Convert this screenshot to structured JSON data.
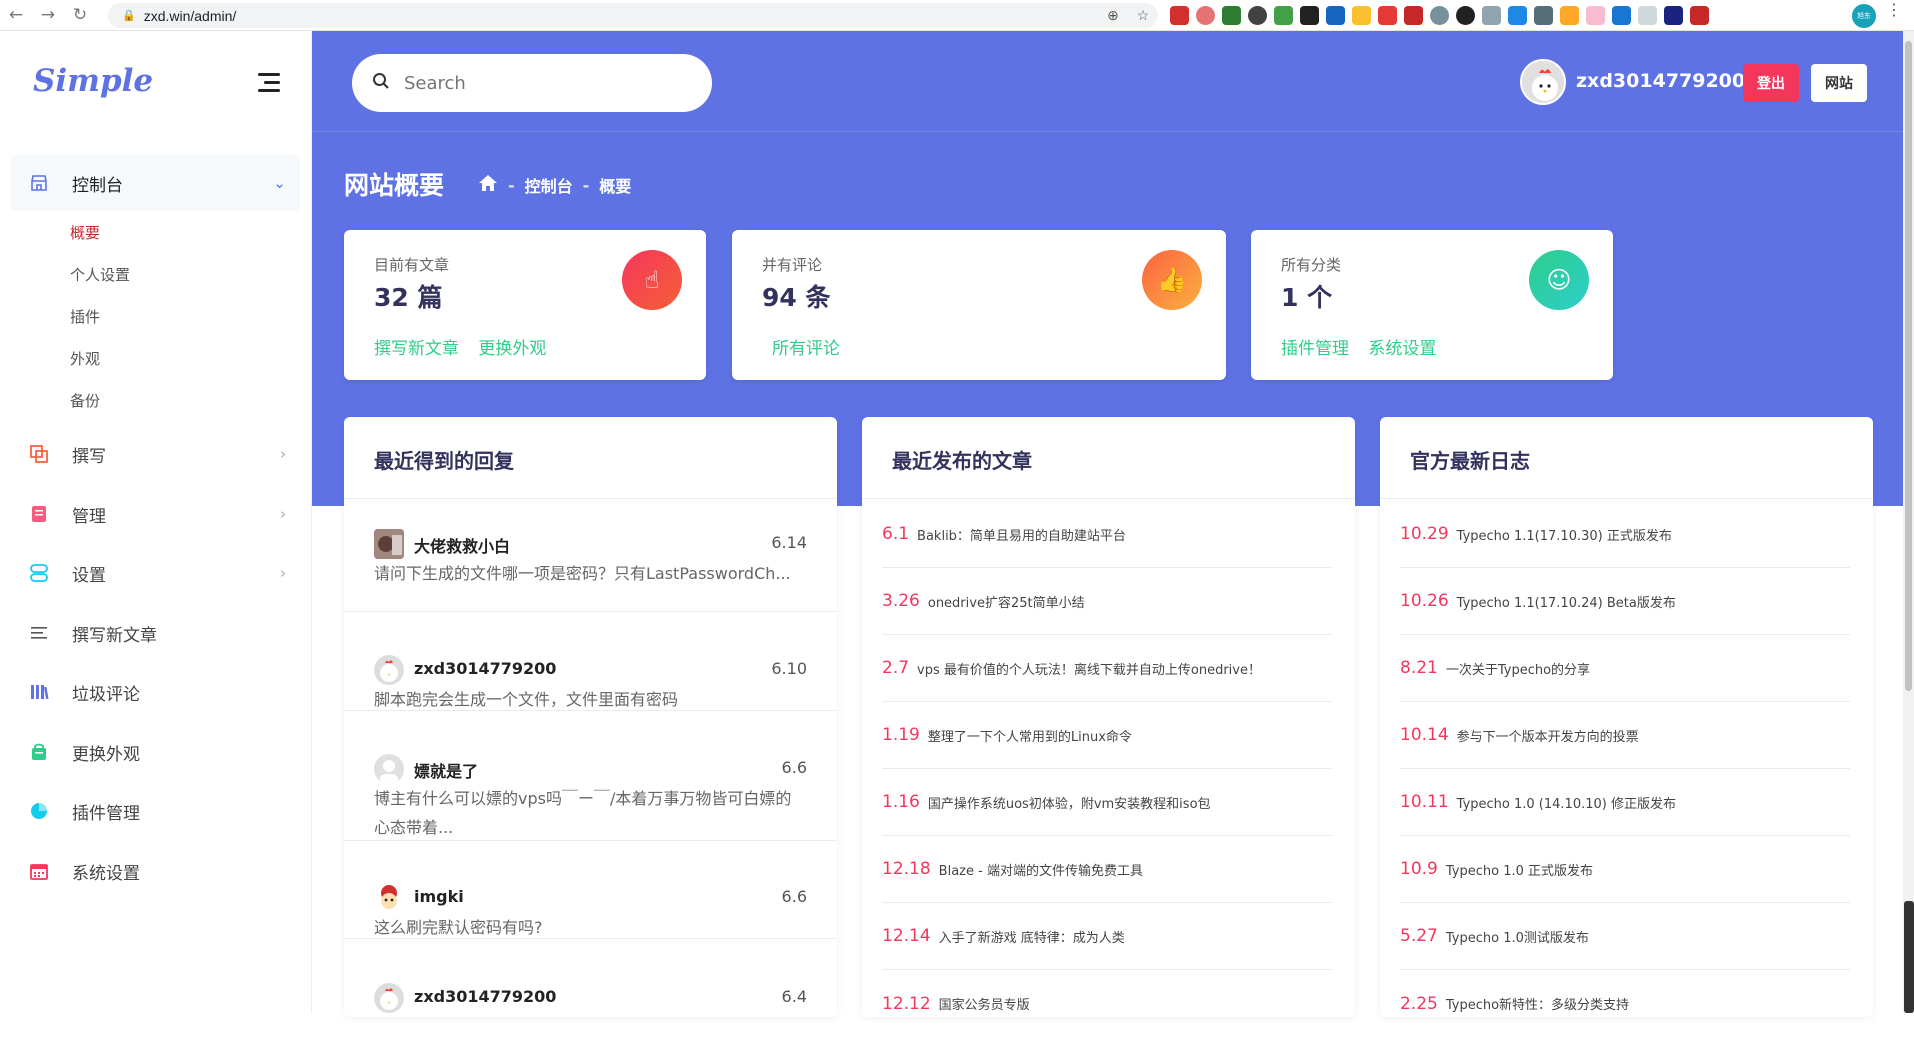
{
  "browser": {
    "url": "zxd.win/admin/",
    "profile_label": "旭东"
  },
  "brand": {
    "logo": "Simple"
  },
  "sidebar": {
    "dashboard": "控制台",
    "sub_items": [
      "概要",
      "个人设置",
      "插件",
      "外观",
      "备份"
    ],
    "items": [
      "撰写",
      "管理",
      "设置",
      "撰写新文章",
      "垃圾评论",
      "更换外观",
      "插件管理",
      "系统设置"
    ]
  },
  "header": {
    "search_placeholder": "Search",
    "username": "zxd3014779200",
    "logout": "登出",
    "site": "网站"
  },
  "page": {
    "title": "网站概要",
    "breadcrumb": [
      "控制台",
      "概要"
    ]
  },
  "stats": [
    {
      "label": "目前有文章",
      "value": "32 篇",
      "links": [
        "撰写新文章",
        "更换外观"
      ],
      "color": "#f5365c"
    },
    {
      "label": "并有评论",
      "value": "94 条",
      "links": [
        "所有评论"
      ],
      "color": "#fb6340"
    },
    {
      "label": "所有分类",
      "value": "1 个",
      "links": [
        "插件管理",
        "系统设置"
      ],
      "color": "#2dce89"
    }
  ],
  "panels": {
    "replies_title": "最近得到的回复",
    "posts_title": "最近发布的文章",
    "logs_title": "官方最新日志"
  },
  "replies": [
    {
      "name": "大佬救救小白",
      "date": "6.14",
      "text": "请问下生成的文件哪一项是密码？只有LastPasswordCh..."
    },
    {
      "name": "zxd3014779200",
      "date": "6.10",
      "text": "脚本跑完会生成一个文件，文件里面有密码"
    },
    {
      "name": "嫖就是了",
      "date": "6.6",
      "text": "博主有什么可以嫖的vps吗￣ー￣/本着万事万物皆可白嫖的心态带着..."
    },
    {
      "name": "imgki",
      "date": "6.6",
      "text": "这么刷完默认密码有吗?"
    },
    {
      "name": "zxd3014779200",
      "date": "6.4",
      "text": ""
    }
  ],
  "posts": [
    {
      "date": "6.1",
      "title": "Baklib：简单且易用的自助建站平台"
    },
    {
      "date": "3.26",
      "title": "onedrive扩容25t简单小结"
    },
    {
      "date": "2.7",
      "title": "vps 最有价值的个人玩法！离线下载并自动上传onedrive！"
    },
    {
      "date": "1.19",
      "title": "整理了一下个人常用到的Linux命令"
    },
    {
      "date": "1.16",
      "title": "国产操作系统uos初体验，附vm安装教程和iso包"
    },
    {
      "date": "12.18",
      "title": "Blaze - 端对端的文件传输免费工具"
    },
    {
      "date": "12.14",
      "title": "入手了新游戏 底特律：成为人类"
    },
    {
      "date": "12.12",
      "title": "国家公务员专版"
    }
  ],
  "logs": [
    {
      "date": "10.29",
      "title": "Typecho 1.1(17.10.30) 正式版发布"
    },
    {
      "date": "10.26",
      "title": "Typecho 1.1(17.10.24) Beta版发布"
    },
    {
      "date": "8.21",
      "title": "一次关于Typecho的分享"
    },
    {
      "date": "10.14",
      "title": "参与下一个版本开发方向的投票"
    },
    {
      "date": "10.11",
      "title": "Typecho 1.0 (14.10.10) 修正版发布"
    },
    {
      "date": "10.9",
      "title": "Typecho 1.0 正式版发布"
    },
    {
      "date": "5.27",
      "title": "Typecho 1.0测试版发布"
    },
    {
      "date": "2.25",
      "title": "Typecho新特性：多级分类支持"
    }
  ]
}
